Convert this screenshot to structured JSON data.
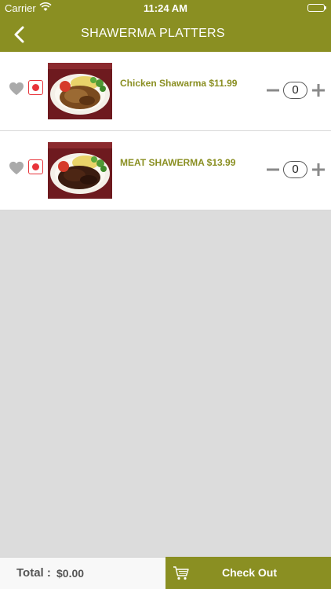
{
  "status_bar": {
    "carrier": "Carrier",
    "time": "11:24 AM"
  },
  "nav": {
    "title": "SHAWERMA PLATTERS",
    "back_icon": "chevron-left-icon"
  },
  "items": [
    {
      "name": "Chicken Shawarma $11.99",
      "quantity": "0",
      "favorite_icon": "heart-icon"
    },
    {
      "name": "MEAT SHAWERMA $13.99",
      "quantity": "0",
      "favorite_icon": "heart-icon"
    }
  ],
  "footer": {
    "total_label": "Total :",
    "total_value": "$0.00",
    "checkout_label": "Check Out",
    "cart_icon": "cart-icon"
  },
  "colors": {
    "primary": "#8a8f22",
    "selection": "#e8343a",
    "background": "#dcdcdc"
  }
}
